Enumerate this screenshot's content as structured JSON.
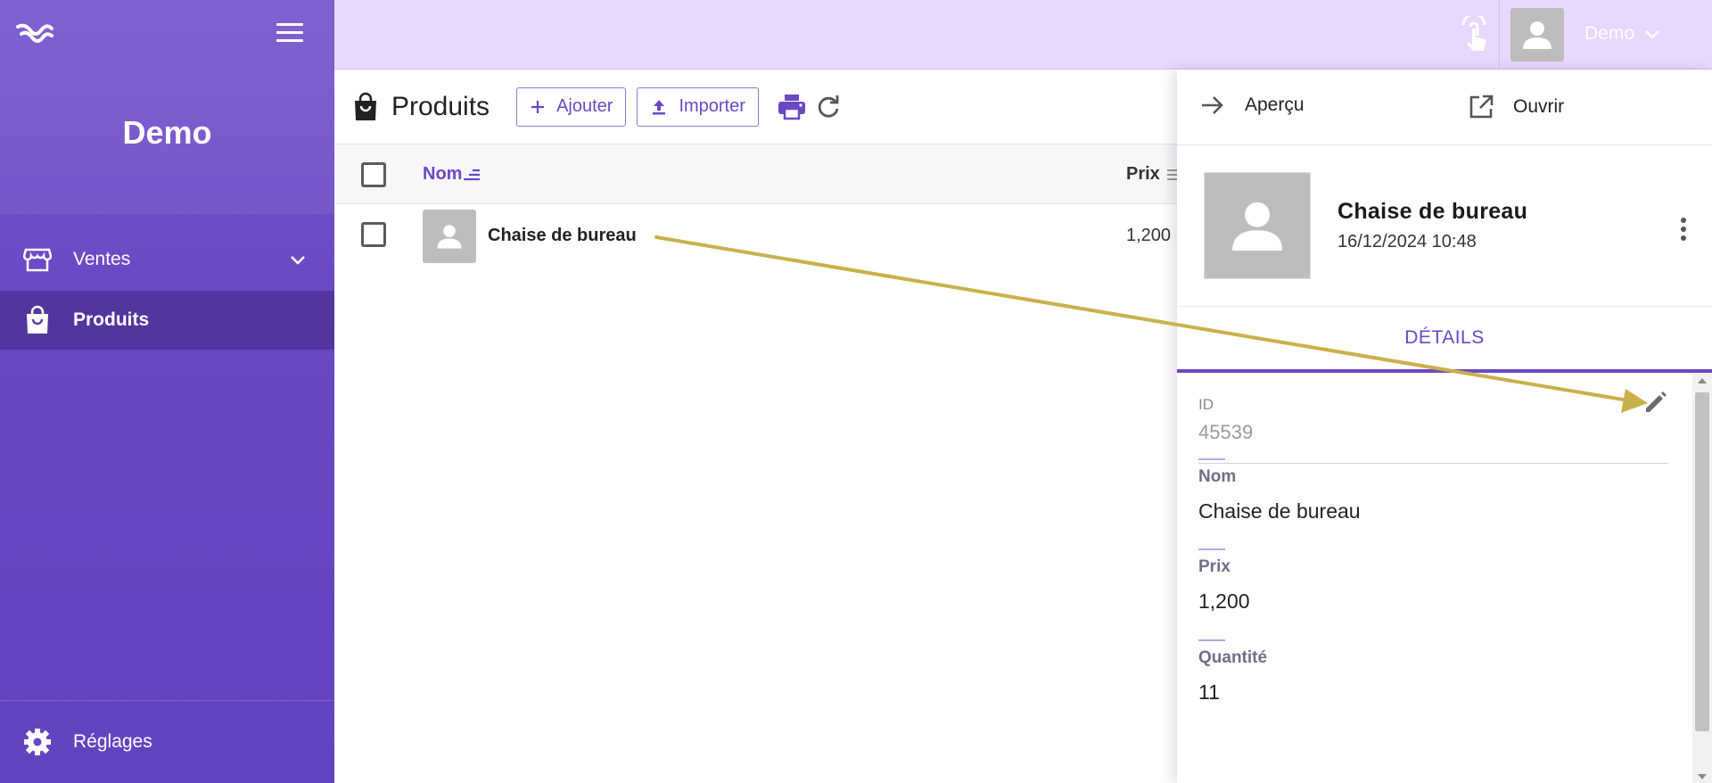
{
  "sidebar": {
    "title": "Demo",
    "items": [
      {
        "label": "Ventes",
        "icon": "store-icon"
      },
      {
        "label": "Produits",
        "icon": "shopping-bag-icon"
      }
    ],
    "footer": {
      "label": "Réglages",
      "icon": "gear-icon"
    }
  },
  "topbar": {
    "user_name": "Demo"
  },
  "main": {
    "title": "Produits",
    "add_label": "Ajouter",
    "import_label": "Importer",
    "columns": {
      "name": "Nom",
      "price": "Prix"
    },
    "rows": [
      {
        "name": "Chaise de bureau",
        "price": "1,200"
      }
    ]
  },
  "panel": {
    "preview_label": "Aperçu",
    "open_label": "Ouvrir",
    "product_name": "Chaise de bureau",
    "date": "16/12/2024 10:48",
    "tab_label": "DÉTAILS",
    "fields": {
      "id_label": "ID",
      "id_value": "45539",
      "name_label": "Nom",
      "name_value": "Chaise de bureau",
      "price_label": "Prix",
      "price_value": "1,200",
      "qty_label": "Quantité",
      "qty_value": "11"
    }
  },
  "colors": {
    "accent": "#6a48c4",
    "sidebar": "#7a57cf",
    "topbar": "#e9d8fd",
    "annotation_arrow": "#c9b04a"
  }
}
